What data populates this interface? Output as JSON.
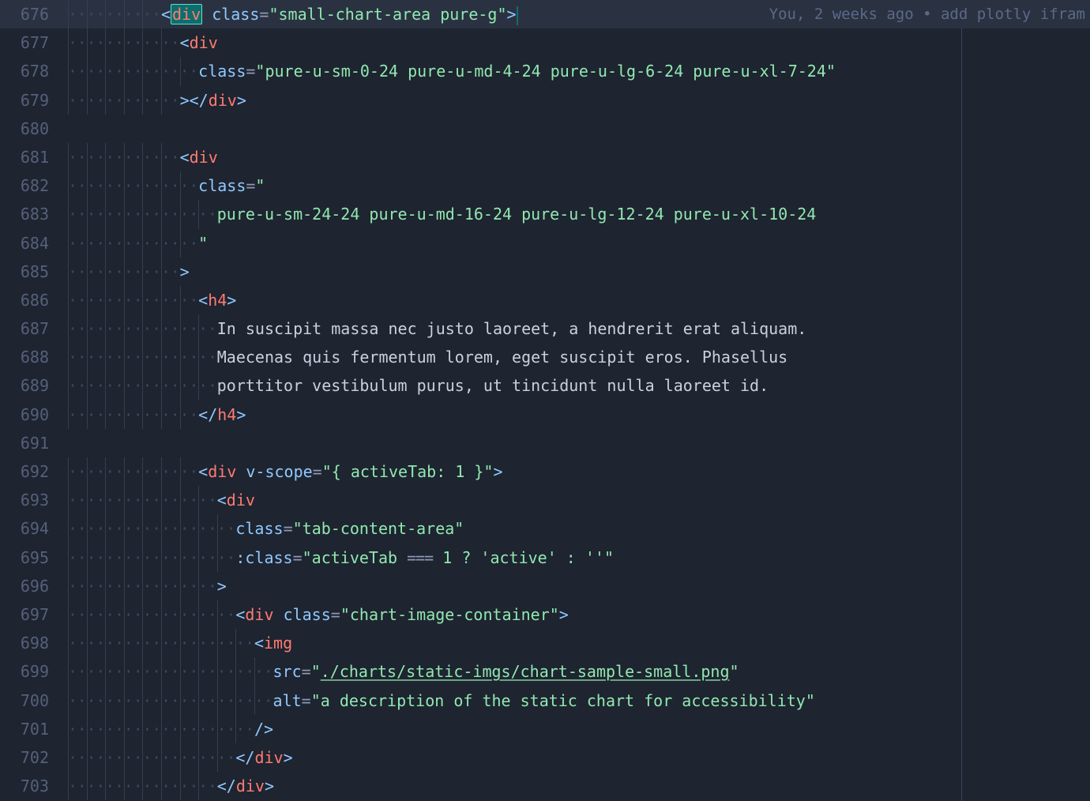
{
  "blame": "You, 2 weeks ago • add plotly ifram",
  "lines": [
    {
      "num": "676",
      "indent": 10,
      "hl": true,
      "tokens": [
        {
          "t": "brk",
          "v": "<"
        },
        {
          "t": "seltag",
          "v": "div"
        },
        {
          "t": "text",
          "v": " "
        },
        {
          "t": "attr",
          "v": "class"
        },
        {
          "t": "eq",
          "v": "="
        },
        {
          "t": "str",
          "v": "\"small-chart-area pure-g\""
        },
        {
          "t": "brk",
          "v": ">"
        },
        {
          "t": "selend",
          "v": ""
        }
      ]
    },
    {
      "num": "677",
      "indent": 12,
      "tokens": [
        {
          "t": "brk",
          "v": "<"
        },
        {
          "t": "tag",
          "v": "div"
        }
      ]
    },
    {
      "num": "678",
      "indent": 14,
      "tokens": [
        {
          "t": "attr",
          "v": "class"
        },
        {
          "t": "eq",
          "v": "="
        },
        {
          "t": "str",
          "v": "\"pure-u-sm-0-24 pure-u-md-4-24 pure-u-lg-6-24 pure-u-xl-7-24\""
        }
      ]
    },
    {
      "num": "679",
      "indent": 12,
      "tokens": [
        {
          "t": "brk",
          "v": "></"
        },
        {
          "t": "tag",
          "v": "div"
        },
        {
          "t": "brk",
          "v": ">"
        }
      ]
    },
    {
      "num": "680",
      "indent": 0,
      "tokens": []
    },
    {
      "num": "681",
      "indent": 12,
      "tokens": [
        {
          "t": "brk",
          "v": "<"
        },
        {
          "t": "tag",
          "v": "div"
        }
      ]
    },
    {
      "num": "682",
      "indent": 14,
      "tokens": [
        {
          "t": "attr",
          "v": "class"
        },
        {
          "t": "eq",
          "v": "="
        },
        {
          "t": "str",
          "v": "\""
        }
      ]
    },
    {
      "num": "683",
      "indent": 16,
      "tokens": [
        {
          "t": "str",
          "v": "pure-u-sm-24-24 pure-u-md-16-24 pure-u-lg-12-24 pure-u-xl-10-24"
        }
      ]
    },
    {
      "num": "684",
      "indent": 14,
      "tokens": [
        {
          "t": "str",
          "v": "\""
        }
      ]
    },
    {
      "num": "685",
      "indent": 12,
      "tokens": [
        {
          "t": "brk",
          "v": ">"
        }
      ]
    },
    {
      "num": "686",
      "indent": 14,
      "tokens": [
        {
          "t": "brk",
          "v": "<"
        },
        {
          "t": "tag",
          "v": "h4"
        },
        {
          "t": "brk",
          "v": ">"
        }
      ]
    },
    {
      "num": "687",
      "indent": 16,
      "tokens": [
        {
          "t": "text",
          "v": "In suscipit massa nec justo laoreet, a hendrerit erat aliquam."
        }
      ]
    },
    {
      "num": "688",
      "indent": 16,
      "tokens": [
        {
          "t": "text",
          "v": "Maecenas quis fermentum lorem, eget suscipit eros. Phasellus"
        }
      ]
    },
    {
      "num": "689",
      "indent": 16,
      "tokens": [
        {
          "t": "text",
          "v": "porttitor vestibulum purus, ut tincidunt nulla laoreet id."
        }
      ]
    },
    {
      "num": "690",
      "indent": 14,
      "tokens": [
        {
          "t": "brk",
          "v": "</"
        },
        {
          "t": "tag",
          "v": "h4"
        },
        {
          "t": "brk",
          "v": ">"
        }
      ]
    },
    {
      "num": "691",
      "indent": 0,
      "tokens": []
    },
    {
      "num": "692",
      "indent": 14,
      "tokens": [
        {
          "t": "brk",
          "v": "<"
        },
        {
          "t": "tag",
          "v": "div"
        },
        {
          "t": "text",
          "v": " "
        },
        {
          "t": "attr",
          "v": "v-scope"
        },
        {
          "t": "eq",
          "v": "="
        },
        {
          "t": "str",
          "v": "\"{ activeTab: 1 }\""
        },
        {
          "t": "brk",
          "v": ">"
        }
      ]
    },
    {
      "num": "693",
      "indent": 16,
      "tokens": [
        {
          "t": "brk",
          "v": "<"
        },
        {
          "t": "tag",
          "v": "div"
        }
      ]
    },
    {
      "num": "694",
      "indent": 18,
      "tokens": [
        {
          "t": "attr",
          "v": "class"
        },
        {
          "t": "eq",
          "v": "="
        },
        {
          "t": "str",
          "v": "\"tab-content-area\""
        }
      ]
    },
    {
      "num": "695",
      "indent": 18,
      "tokens": [
        {
          "t": "attr",
          "v": ":class"
        },
        {
          "t": "eq",
          "v": "="
        },
        {
          "t": "str",
          "v": "\"activeTab "
        },
        {
          "t": "lig",
          "v": "==="
        },
        {
          "t": "str",
          "v": " 1 ? 'active' : ''\""
        }
      ]
    },
    {
      "num": "696",
      "indent": 16,
      "tokens": [
        {
          "t": "brk",
          "v": ">"
        }
      ]
    },
    {
      "num": "697",
      "indent": 18,
      "tokens": [
        {
          "t": "brk",
          "v": "<"
        },
        {
          "t": "tag",
          "v": "div"
        },
        {
          "t": "text",
          "v": " "
        },
        {
          "t": "attr",
          "v": "class"
        },
        {
          "t": "eq",
          "v": "="
        },
        {
          "t": "str",
          "v": "\"chart-image-container\""
        },
        {
          "t": "brk",
          "v": ">"
        }
      ]
    },
    {
      "num": "698",
      "indent": 20,
      "tokens": [
        {
          "t": "brk",
          "v": "<"
        },
        {
          "t": "tag",
          "v": "img"
        }
      ]
    },
    {
      "num": "699",
      "indent": 22,
      "tokens": [
        {
          "t": "attr",
          "v": "src"
        },
        {
          "t": "eq",
          "v": "="
        },
        {
          "t": "str",
          "v": "\""
        },
        {
          "t": "strlink",
          "v": "./charts/static-imgs/chart-sample-small.png"
        },
        {
          "t": "str",
          "v": "\""
        }
      ]
    },
    {
      "num": "700",
      "indent": 22,
      "tokens": [
        {
          "t": "attr",
          "v": "alt"
        },
        {
          "t": "eq",
          "v": "="
        },
        {
          "t": "str",
          "v": "\"a description of the static chart for accessibility\""
        }
      ]
    },
    {
      "num": "701",
      "indent": 20,
      "tokens": [
        {
          "t": "brk",
          "v": "/>"
        }
      ]
    },
    {
      "num": "702",
      "indent": 18,
      "tokens": [
        {
          "t": "brk",
          "v": "</"
        },
        {
          "t": "tag",
          "v": "div"
        },
        {
          "t": "brk",
          "v": ">"
        }
      ]
    },
    {
      "num": "703",
      "indent": 16,
      "tokens": [
        {
          "t": "brk",
          "v": "</"
        },
        {
          "t": "tag",
          "v": "div"
        },
        {
          "t": "brk",
          "v": ">"
        }
      ]
    }
  ]
}
